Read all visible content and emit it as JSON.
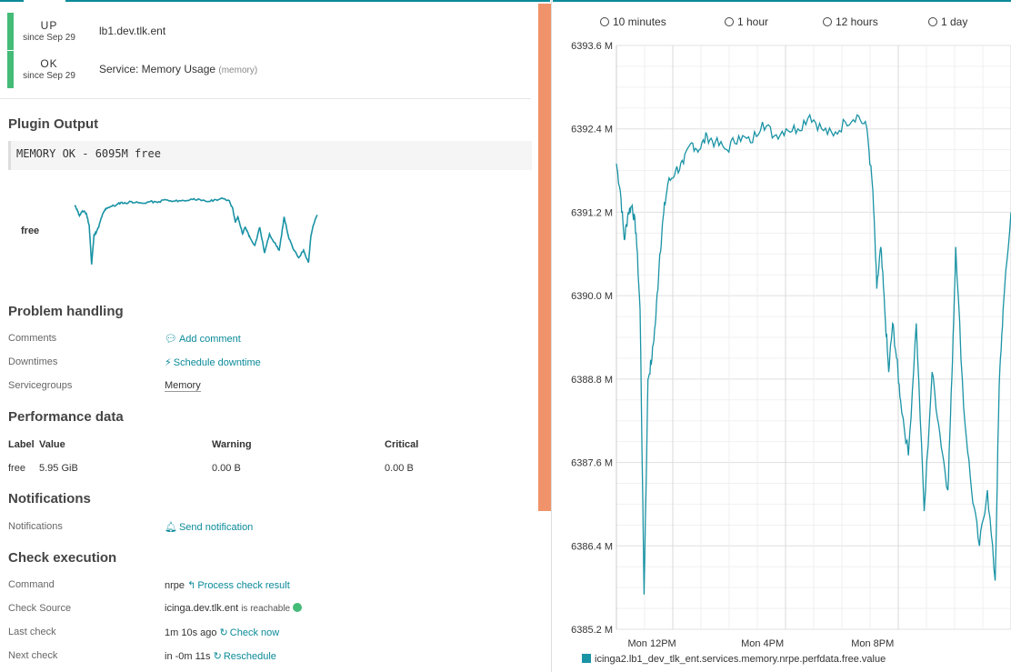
{
  "host_state": {
    "state": "UP",
    "since": "since Sep 29",
    "name": "lb1.dev.tlk.ent"
  },
  "service_state": {
    "state": "OK",
    "since": "since Sep 29",
    "name": "Service: Memory Usage",
    "sub": "(memory)"
  },
  "plugin_output": {
    "title": "Plugin Output",
    "text": "MEMORY OK - 6095M free",
    "sparkline_label": "free"
  },
  "problem_handling": {
    "title": "Problem handling",
    "rows": [
      {
        "label": "Comments",
        "value": "Add comment",
        "icon": "comment-icon"
      },
      {
        "label": "Downtimes",
        "value": "Schedule downtime",
        "icon": "plug-icon"
      },
      {
        "label": "Servicegroups",
        "value": "Memory"
      }
    ]
  },
  "performance": {
    "title": "Performance data",
    "headers": [
      "Label",
      "Value",
      "Warning",
      "Critical"
    ],
    "row": [
      "free",
      "5.95 GiB",
      "0.00 B",
      "0.00 B"
    ]
  },
  "notifications": {
    "title": "Notifications",
    "label": "Notifications",
    "action": "Send notification",
    "icon": "bell-icon"
  },
  "check_execution": {
    "title": "Check execution",
    "command_label": "Command",
    "command": "nrpe",
    "command_action": "Process check result",
    "source_label": "Check Source",
    "source": "icinga.dev.tlk.ent",
    "source_status": "is reachable",
    "last_label": "Last check",
    "last": "1m 10s ago",
    "last_action": "Check now",
    "next_label": "Next check",
    "next": "in -0m 11s",
    "next_action": "Reschedule"
  },
  "tabs": [
    "10 minutes",
    "1 hour",
    "12 hours",
    "1 day"
  ],
  "colors": {
    "accent": "#0b8a99",
    "ok": "#44bb77",
    "divider": "#f0936b",
    "series": "#1a93a5"
  },
  "chart_data": {
    "type": "line",
    "ylim": [
      6385.2,
      6393.6
    ],
    "yticks": [
      "6385.2 M",
      "6386.4 M",
      "6387.6 M",
      "6388.8 M",
      "6390.0 M",
      "6391.2 M",
      "6392.4 M",
      "6393.6 M"
    ],
    "ytick_values": [
      6385.2,
      6386.4,
      6387.6,
      6388.8,
      6390.0,
      6391.2,
      6392.4,
      6393.6
    ],
    "xticks": [
      "Mon 12PM",
      "Mon 4PM",
      "Mon 8PM"
    ],
    "xtick_positions": [
      0.233,
      0.513,
      0.792
    ],
    "legend": "icinga2.lb1_dev_tlk_ent.services.memory.nrpe.perfdata.free.value",
    "series": [
      {
        "name": "icinga2.lb1_dev_tlk_ent.services.memory.nrpe.perfdata.free.value",
        "x": [
          0,
          0.01,
          0.02,
          0.03,
          0.04,
          0.05,
          0.06,
          0.07,
          0.08,
          0.09,
          0.1,
          0.11,
          0.12,
          0.13,
          0.15,
          0.17,
          0.19,
          0.21,
          0.23,
          0.25,
          0.28,
          0.31,
          0.34,
          0.37,
          0.4,
          0.43,
          0.46,
          0.49,
          0.52,
          0.55,
          0.58,
          0.61,
          0.635,
          0.65,
          0.66,
          0.67,
          0.68,
          0.69,
          0.7,
          0.71,
          0.72,
          0.74,
          0.76,
          0.78,
          0.8,
          0.82,
          0.84,
          0.85,
          0.86,
          0.88,
          0.9,
          0.92,
          0.94,
          0.96,
          0.97,
          0.98,
          1.0
        ],
        "y": [
          6391.9,
          6391.5,
          6390.8,
          6391.2,
          6391.3,
          6390.9,
          6389.8,
          6385.7,
          6388.8,
          6389.1,
          6389.7,
          6390.6,
          6391.2,
          6391.6,
          6391.8,
          6391.9,
          6392.2,
          6392.1,
          6392.3,
          6392.2,
          6392.1,
          6392.3,
          6392.2,
          6392.5,
          6392.3,
          6392.4,
          6392.4,
          6392.6,
          6392.4,
          6392.3,
          6392.5,
          6392.6,
          6392.4,
          6391.5,
          6390.1,
          6390.7,
          6389.8,
          6388.9,
          6389.6,
          6389.1,
          6388.5,
          6387.7,
          6389.6,
          6386.9,
          6388.9,
          6388.0,
          6387.2,
          6388.8,
          6390.7,
          6388.4,
          6387.2,
          6386.4,
          6387.2,
          6385.9,
          6388.7,
          6389.8,
          6391.2
        ]
      }
    ]
  }
}
